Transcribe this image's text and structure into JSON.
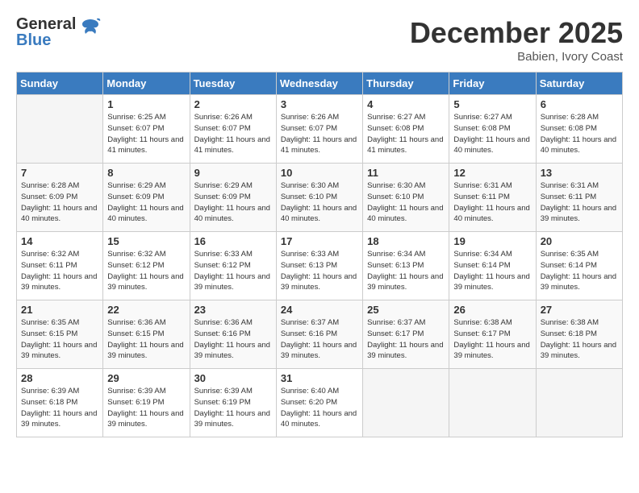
{
  "header": {
    "logo_general": "General",
    "logo_blue": "Blue",
    "month_title": "December 2025",
    "location": "Babien, Ivory Coast"
  },
  "days_of_week": [
    "Sunday",
    "Monday",
    "Tuesday",
    "Wednesday",
    "Thursday",
    "Friday",
    "Saturday"
  ],
  "weeks": [
    [
      {
        "day": "",
        "sunrise": "",
        "sunset": "",
        "daylight": ""
      },
      {
        "day": "1",
        "sunrise": "Sunrise: 6:25 AM",
        "sunset": "Sunset: 6:07 PM",
        "daylight": "Daylight: 11 hours and 41 minutes."
      },
      {
        "day": "2",
        "sunrise": "Sunrise: 6:26 AM",
        "sunset": "Sunset: 6:07 PM",
        "daylight": "Daylight: 11 hours and 41 minutes."
      },
      {
        "day": "3",
        "sunrise": "Sunrise: 6:26 AM",
        "sunset": "Sunset: 6:07 PM",
        "daylight": "Daylight: 11 hours and 41 minutes."
      },
      {
        "day": "4",
        "sunrise": "Sunrise: 6:27 AM",
        "sunset": "Sunset: 6:08 PM",
        "daylight": "Daylight: 11 hours and 41 minutes."
      },
      {
        "day": "5",
        "sunrise": "Sunrise: 6:27 AM",
        "sunset": "Sunset: 6:08 PM",
        "daylight": "Daylight: 11 hours and 40 minutes."
      },
      {
        "day": "6",
        "sunrise": "Sunrise: 6:28 AM",
        "sunset": "Sunset: 6:08 PM",
        "daylight": "Daylight: 11 hours and 40 minutes."
      }
    ],
    [
      {
        "day": "7",
        "sunrise": "Sunrise: 6:28 AM",
        "sunset": "Sunset: 6:09 PM",
        "daylight": "Daylight: 11 hours and 40 minutes."
      },
      {
        "day": "8",
        "sunrise": "Sunrise: 6:29 AM",
        "sunset": "Sunset: 6:09 PM",
        "daylight": "Daylight: 11 hours and 40 minutes."
      },
      {
        "day": "9",
        "sunrise": "Sunrise: 6:29 AM",
        "sunset": "Sunset: 6:09 PM",
        "daylight": "Daylight: 11 hours and 40 minutes."
      },
      {
        "day": "10",
        "sunrise": "Sunrise: 6:30 AM",
        "sunset": "Sunset: 6:10 PM",
        "daylight": "Daylight: 11 hours and 40 minutes."
      },
      {
        "day": "11",
        "sunrise": "Sunrise: 6:30 AM",
        "sunset": "Sunset: 6:10 PM",
        "daylight": "Daylight: 11 hours and 40 minutes."
      },
      {
        "day": "12",
        "sunrise": "Sunrise: 6:31 AM",
        "sunset": "Sunset: 6:11 PM",
        "daylight": "Daylight: 11 hours and 40 minutes."
      },
      {
        "day": "13",
        "sunrise": "Sunrise: 6:31 AM",
        "sunset": "Sunset: 6:11 PM",
        "daylight": "Daylight: 11 hours and 39 minutes."
      }
    ],
    [
      {
        "day": "14",
        "sunrise": "Sunrise: 6:32 AM",
        "sunset": "Sunset: 6:11 PM",
        "daylight": "Daylight: 11 hours and 39 minutes."
      },
      {
        "day": "15",
        "sunrise": "Sunrise: 6:32 AM",
        "sunset": "Sunset: 6:12 PM",
        "daylight": "Daylight: 11 hours and 39 minutes."
      },
      {
        "day": "16",
        "sunrise": "Sunrise: 6:33 AM",
        "sunset": "Sunset: 6:12 PM",
        "daylight": "Daylight: 11 hours and 39 minutes."
      },
      {
        "day": "17",
        "sunrise": "Sunrise: 6:33 AM",
        "sunset": "Sunset: 6:13 PM",
        "daylight": "Daylight: 11 hours and 39 minutes."
      },
      {
        "day": "18",
        "sunrise": "Sunrise: 6:34 AM",
        "sunset": "Sunset: 6:13 PM",
        "daylight": "Daylight: 11 hours and 39 minutes."
      },
      {
        "day": "19",
        "sunrise": "Sunrise: 6:34 AM",
        "sunset": "Sunset: 6:14 PM",
        "daylight": "Daylight: 11 hours and 39 minutes."
      },
      {
        "day": "20",
        "sunrise": "Sunrise: 6:35 AM",
        "sunset": "Sunset: 6:14 PM",
        "daylight": "Daylight: 11 hours and 39 minutes."
      }
    ],
    [
      {
        "day": "21",
        "sunrise": "Sunrise: 6:35 AM",
        "sunset": "Sunset: 6:15 PM",
        "daylight": "Daylight: 11 hours and 39 minutes."
      },
      {
        "day": "22",
        "sunrise": "Sunrise: 6:36 AM",
        "sunset": "Sunset: 6:15 PM",
        "daylight": "Daylight: 11 hours and 39 minutes."
      },
      {
        "day": "23",
        "sunrise": "Sunrise: 6:36 AM",
        "sunset": "Sunset: 6:16 PM",
        "daylight": "Daylight: 11 hours and 39 minutes."
      },
      {
        "day": "24",
        "sunrise": "Sunrise: 6:37 AM",
        "sunset": "Sunset: 6:16 PM",
        "daylight": "Daylight: 11 hours and 39 minutes."
      },
      {
        "day": "25",
        "sunrise": "Sunrise: 6:37 AM",
        "sunset": "Sunset: 6:17 PM",
        "daylight": "Daylight: 11 hours and 39 minutes."
      },
      {
        "day": "26",
        "sunrise": "Sunrise: 6:38 AM",
        "sunset": "Sunset: 6:17 PM",
        "daylight": "Daylight: 11 hours and 39 minutes."
      },
      {
        "day": "27",
        "sunrise": "Sunrise: 6:38 AM",
        "sunset": "Sunset: 6:18 PM",
        "daylight": "Daylight: 11 hours and 39 minutes."
      }
    ],
    [
      {
        "day": "28",
        "sunrise": "Sunrise: 6:39 AM",
        "sunset": "Sunset: 6:18 PM",
        "daylight": "Daylight: 11 hours and 39 minutes."
      },
      {
        "day": "29",
        "sunrise": "Sunrise: 6:39 AM",
        "sunset": "Sunset: 6:19 PM",
        "daylight": "Daylight: 11 hours and 39 minutes."
      },
      {
        "day": "30",
        "sunrise": "Sunrise: 6:39 AM",
        "sunset": "Sunset: 6:19 PM",
        "daylight": "Daylight: 11 hours and 39 minutes."
      },
      {
        "day": "31",
        "sunrise": "Sunrise: 6:40 AM",
        "sunset": "Sunset: 6:20 PM",
        "daylight": "Daylight: 11 hours and 40 minutes."
      },
      {
        "day": "",
        "sunrise": "",
        "sunset": "",
        "daylight": ""
      },
      {
        "day": "",
        "sunrise": "",
        "sunset": "",
        "daylight": ""
      },
      {
        "day": "",
        "sunrise": "",
        "sunset": "",
        "daylight": ""
      }
    ]
  ]
}
